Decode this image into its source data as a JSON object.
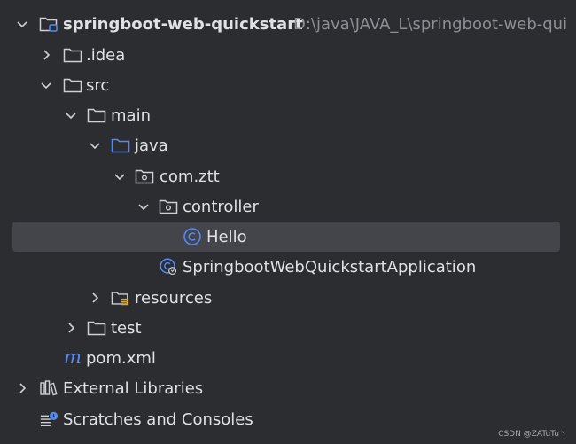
{
  "tree": {
    "project": {
      "label": "springboot-web-quickstart",
      "path": "D:\\java\\JAVA_L\\springboot-web-qui"
    },
    "idea": {
      "label": ".idea"
    },
    "src": {
      "label": "src"
    },
    "main": {
      "label": "main"
    },
    "java": {
      "label": "java"
    },
    "package": {
      "label": "com.ztt"
    },
    "controller": {
      "label": "controller"
    },
    "hello": {
      "label": "Hello"
    },
    "application": {
      "label": "SpringbootWebQuickstartApplication"
    },
    "resources": {
      "label": "resources"
    },
    "test": {
      "label": "test"
    },
    "pom": {
      "label": "pom.xml"
    },
    "external_libraries": {
      "label": "External Libraries"
    },
    "scratches": {
      "label": "Scratches and Consoles"
    }
  },
  "watermark": "CSDN @ZATuTu丶",
  "colors": {
    "background": "#2b2d30",
    "selection": "#43454a",
    "text": "#dfe1e5",
    "path_text": "#8c8f94",
    "accent_blue": "#548af7"
  }
}
